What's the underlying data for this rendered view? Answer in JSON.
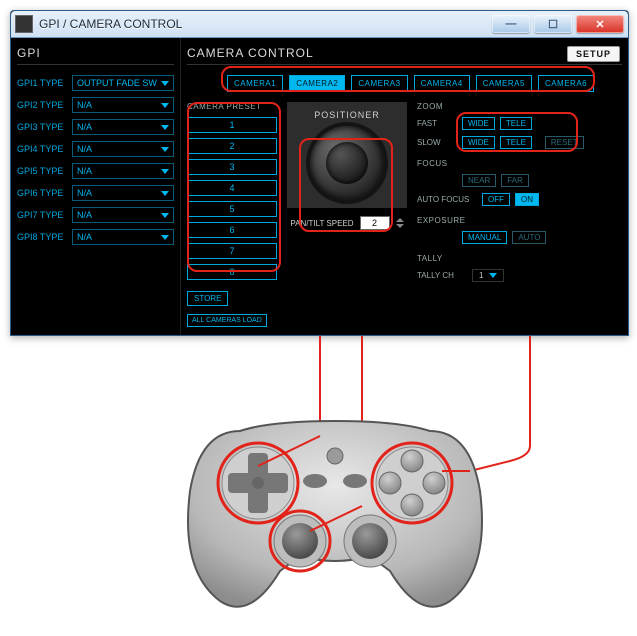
{
  "window": {
    "title": "GPI / CAMERA CONTROL"
  },
  "gpi": {
    "title": "GPI",
    "rows": [
      {
        "label": "GPI1 TYPE",
        "value": "OUTPUT FADE SW"
      },
      {
        "label": "GPI2 TYPE",
        "value": "N/A"
      },
      {
        "label": "GPI3 TYPE",
        "value": "N/A"
      },
      {
        "label": "GPI4 TYPE",
        "value": "N/A"
      },
      {
        "label": "GPI5 TYPE",
        "value": "N/A"
      },
      {
        "label": "GPI6 TYPE",
        "value": "N/A"
      },
      {
        "label": "GPI7 TYPE",
        "value": "N/A"
      },
      {
        "label": "GPI8 TYPE",
        "value": "N/A"
      }
    ]
  },
  "cam": {
    "title": "CAMERA CONTROL",
    "setup": "SETUP",
    "tabs": [
      "CAMERA1",
      "CAMERA2",
      "CAMERA3",
      "CAMERA4",
      "CAMERA5",
      "CAMERA6"
    ],
    "active_tab": 1,
    "preset_head": "CAMERA PRESET",
    "presets": [
      "1",
      "2",
      "3",
      "4",
      "5",
      "6",
      "7",
      "8"
    ],
    "store": "STORE",
    "all_load": "ALL CAMERAS LOAD",
    "positioner": "POSITIONER",
    "pt_label": "PAN/TILT SPEED",
    "pt_value": "2",
    "zoom": {
      "head": "ZOOM",
      "fast": "FAST",
      "slow": "SLOW",
      "wide": "WIDE",
      "tele": "TELE",
      "reset": "RESET"
    },
    "focus": {
      "head": "FOCUS",
      "near": "NEAR",
      "far": "FAR",
      "auto": "AUTO FOCUS",
      "off": "OFF",
      "on": "ON"
    },
    "exposure": {
      "head": "EXPOSURE",
      "manual": "MANUAL",
      "auto": "AUTO"
    },
    "tally": {
      "head": "TALLY",
      "ch": "TALLY CH",
      "value": "1"
    }
  }
}
